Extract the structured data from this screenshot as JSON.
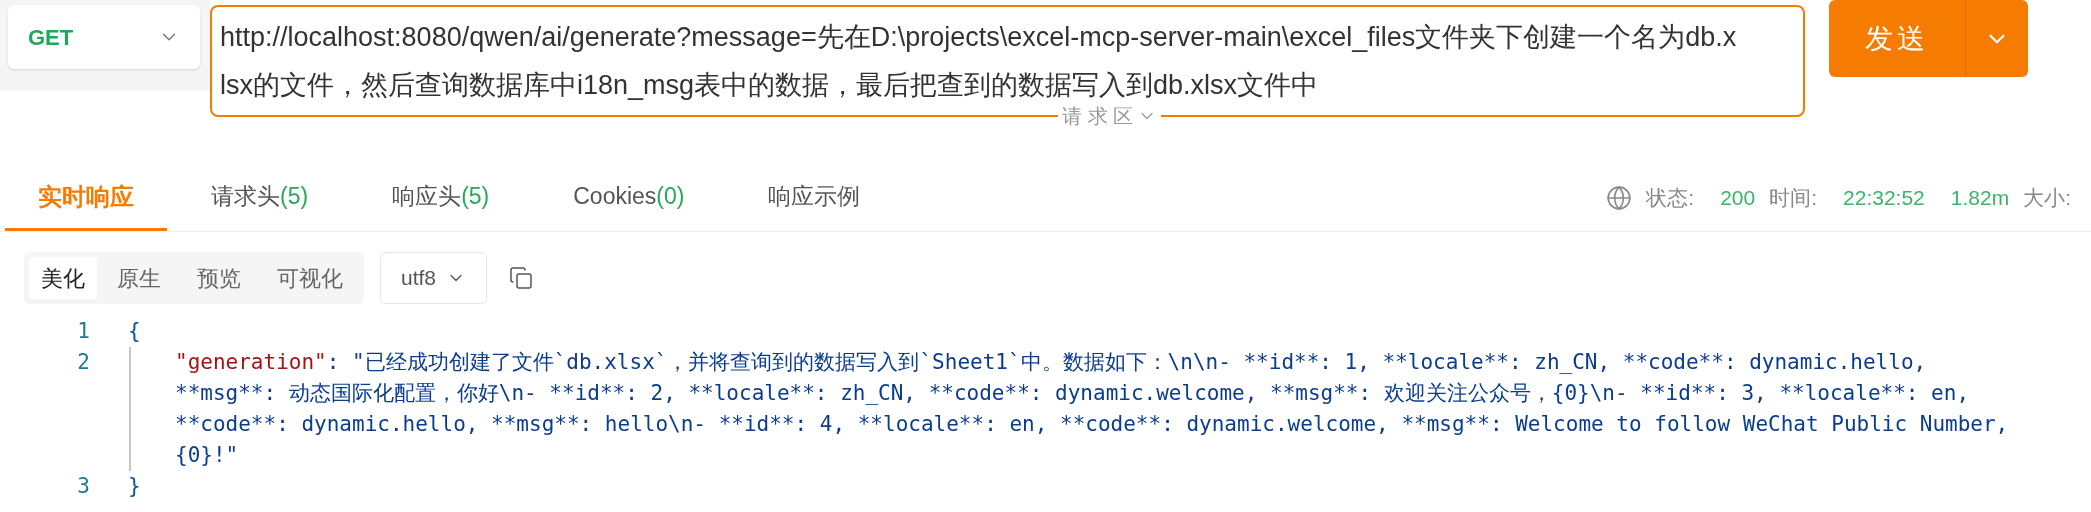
{
  "request": {
    "method": "GET",
    "url_lines": [
      "http://localhost:8080/qwen/ai/generate?message=先在D:\\projects\\excel-mcp-server-main\\excel_files文件夹下创建一个名为db.x",
      "lsx的文件，然后查询数据库中i18n_msg表中的数据，最后把查到的数据写入到db.xlsx文件中"
    ],
    "send_label": "发送",
    "area_label": "请 求 区"
  },
  "tabs": [
    {
      "label": "实时响应",
      "selected": true
    },
    {
      "label": "请求头",
      "count": "(5)",
      "selected": false
    },
    {
      "label": "响应头",
      "count": "(5)",
      "selected": false
    },
    {
      "label": "Cookies",
      "count": "(0)",
      "selected": false
    },
    {
      "label": "响应示例",
      "selected": false
    }
  ],
  "status": [
    {
      "label": "状态:",
      "value": "200"
    },
    {
      "label": "时间:",
      "value": "22:32:52"
    },
    {
      "value": "1.82m"
    },
    {
      "label": "大小:"
    }
  ],
  "view_modes": [
    {
      "label": "美化",
      "selected": true
    },
    {
      "label": "原生",
      "selected": false
    },
    {
      "label": "预览",
      "selected": false
    },
    {
      "label": "可视化",
      "selected": false
    }
  ],
  "encoding": "utf8",
  "code": [
    {
      "number": "1",
      "kind": "punct",
      "text": "{"
    },
    {
      "number": "2",
      "kind": "pair",
      "key": "\"generation\"",
      "separator": ": ",
      "value_lines": [
        "\"已经成功创建了文件`db.xlsx`，并将查询到的数据写入到`Sheet1`中。数据如下：\\n\\n- **id**: 1, **locale**: zh_CN, **code**: dynamic.hello,",
        "**msg**: 动态国际化配置，你好\\n- **id**: 2, **locale**: zh_CN, **code**: dynamic.welcome, **msg**: 欢迎关注公众号，{0}\\n- **id**: 3, **locale**: en,",
        "**code**: dynamic.hello, **msg**: hello\\n- **id**: 4, **locale**: en, **code**: dynamic.welcome, **msg**: Welcome to follow WeChat Public Number,",
        "{0}!\""
      ]
    },
    {
      "number": "3",
      "kind": "punct",
      "text": "}"
    }
  ]
}
